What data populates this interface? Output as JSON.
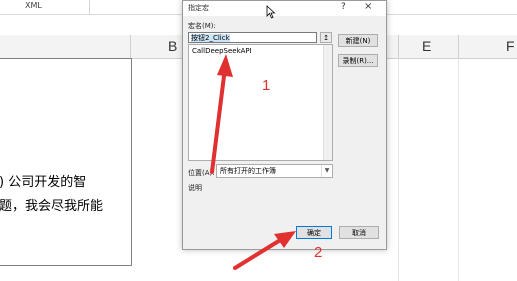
{
  "excel": {
    "ribbon_text": "XML",
    "columns": [
      "B",
      "E",
      "F"
    ],
    "cell_text_lines": [
      ") 公司开发的智",
      "题，我会尽我所能"
    ]
  },
  "dialog": {
    "title": "指定宏",
    "help_label": "?",
    "close_label": "×",
    "macro_name_label": "宏名(M):",
    "macro_name_value": "按钮2_Click",
    "upload_icon": "↥",
    "macro_list": [
      "CallDeepSeekAPI"
    ],
    "new_button": "新建(N)",
    "record_button": "录制(R)...",
    "location_label": "位置(A):",
    "location_value": "所有打开的工作簿",
    "description_label": "说明",
    "ok_button": "确定",
    "cancel_button": "取消"
  },
  "annotations": {
    "step1": "1",
    "step2": "2",
    "color": "#e03030"
  }
}
